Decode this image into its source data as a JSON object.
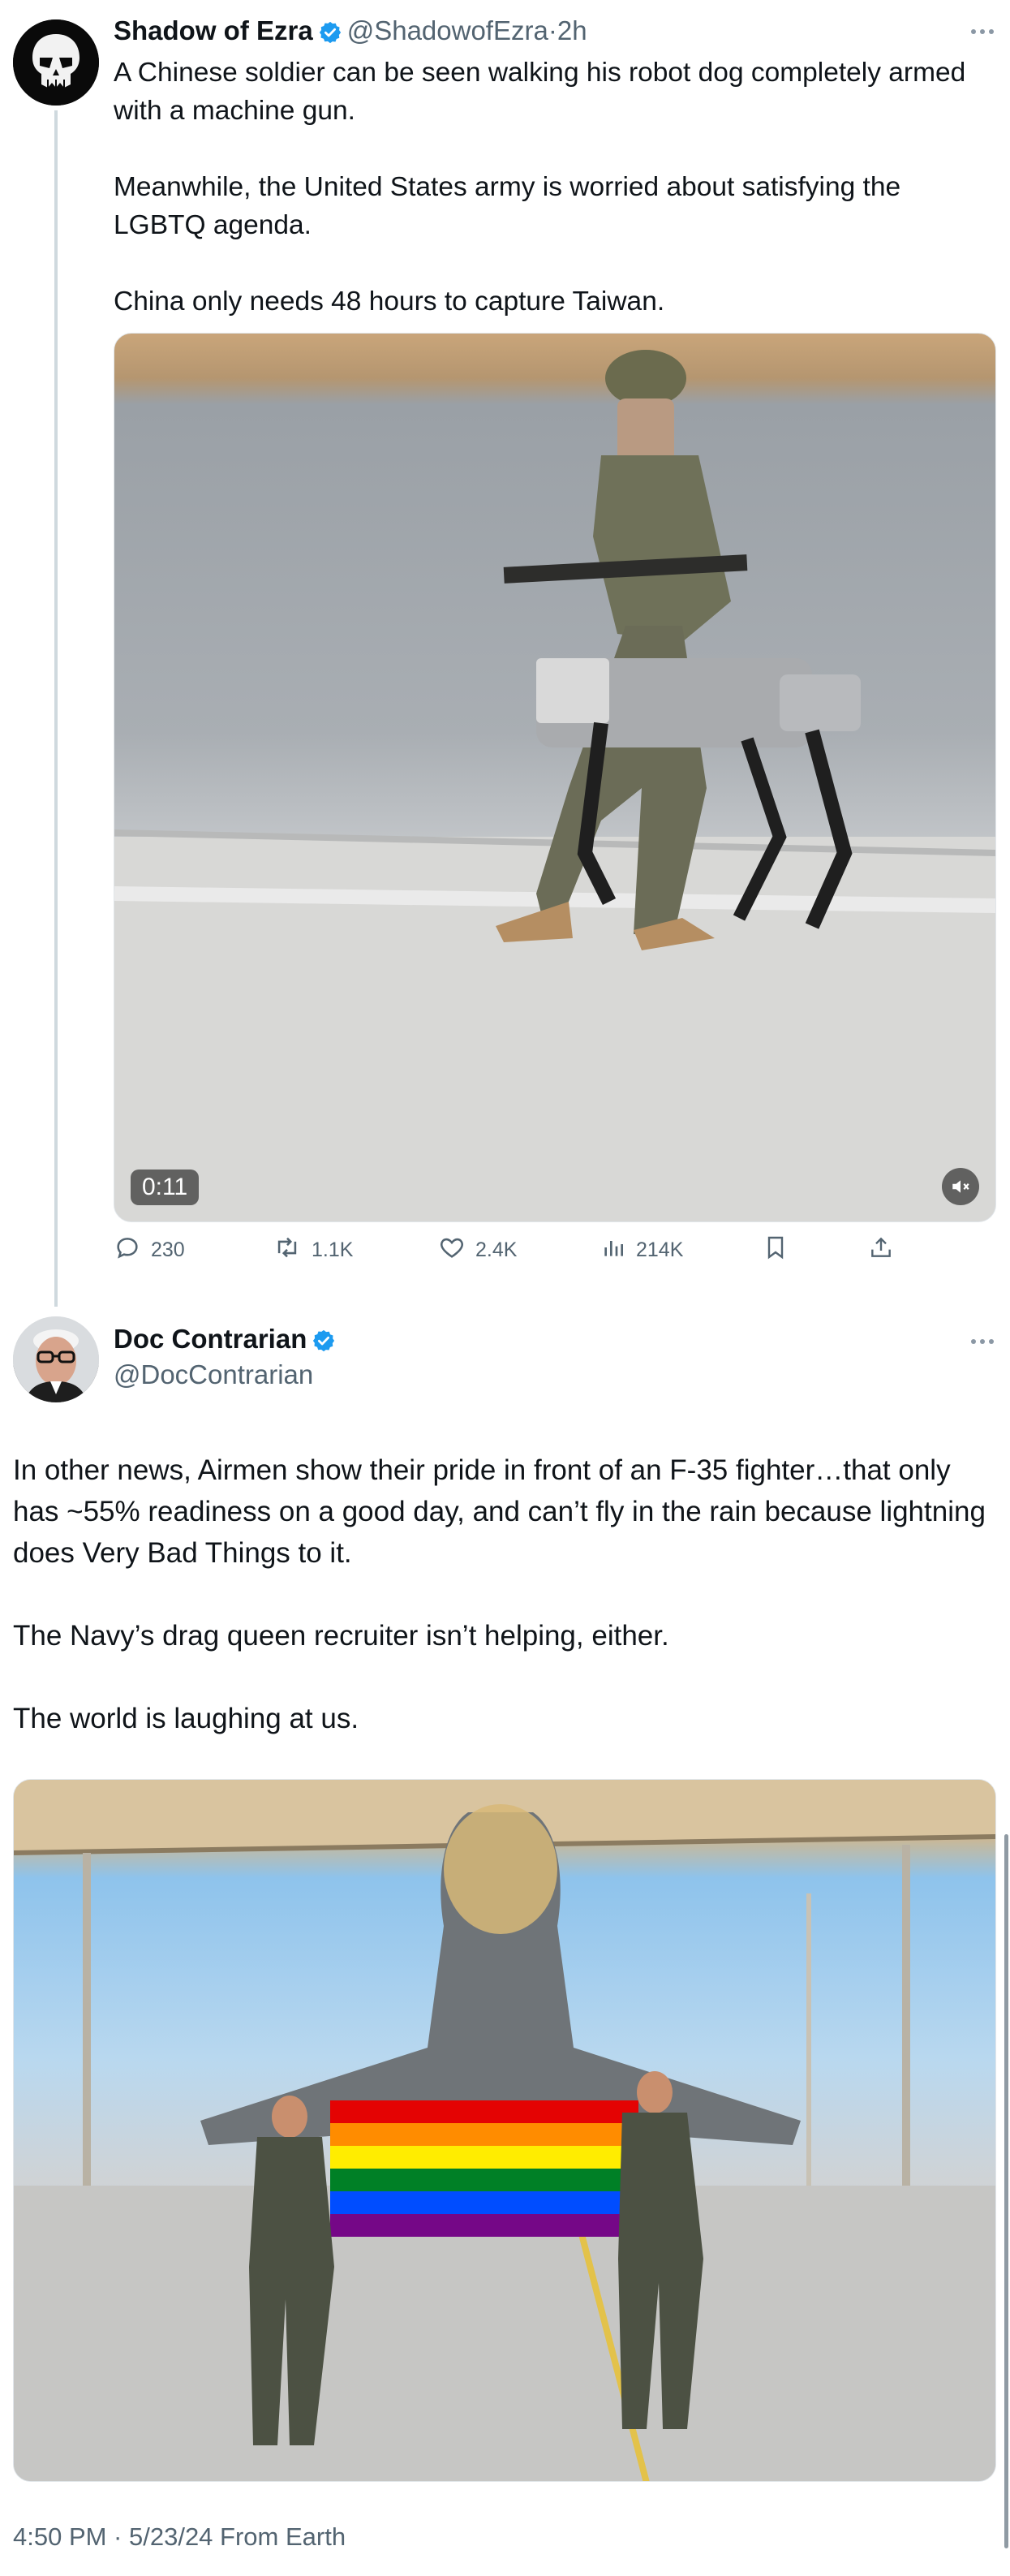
{
  "tweet1": {
    "display_name": "Shadow of Ezra",
    "handle": "@ShadowofEzra",
    "separator": "·",
    "age": "2h",
    "text": "A Chinese soldier can be seen walking his robot dog completely armed with a machine gun.\n\nMeanwhile, the United States army is worried about satisfying the LGBTQ agenda.\n\nChina only needs 48 hours to capture Taiwan.",
    "video": {
      "duration": "0:11"
    },
    "actions": {
      "replies": "230",
      "reposts": "1.1K",
      "likes": "2.4K",
      "views": "214K"
    }
  },
  "tweet2": {
    "display_name": "Doc Contrarian",
    "handle": "@DocContrarian",
    "text": "In other news, Airmen show their pride in front of an F-35 fighter…that only has ~55% readiness on a good day, and can’t fly in the rain because lightning does Very Bad Things to it.\n\nThe Navy’s drag queen recruiter isn’t helping, either.\n\nThe world is laughing at us.",
    "timestamp": "4:50 PM · 5/23/24 From Earth"
  },
  "colors": {
    "verified_blue": "#1d9bf0",
    "muted_text": "#536471",
    "thread_line": "#cfd9de"
  },
  "icons": [
    "verified-badge-icon",
    "more-icon",
    "reply-icon",
    "repost-icon",
    "like-icon",
    "views-icon",
    "bookmark-icon",
    "share-icon",
    "mute-icon"
  ]
}
